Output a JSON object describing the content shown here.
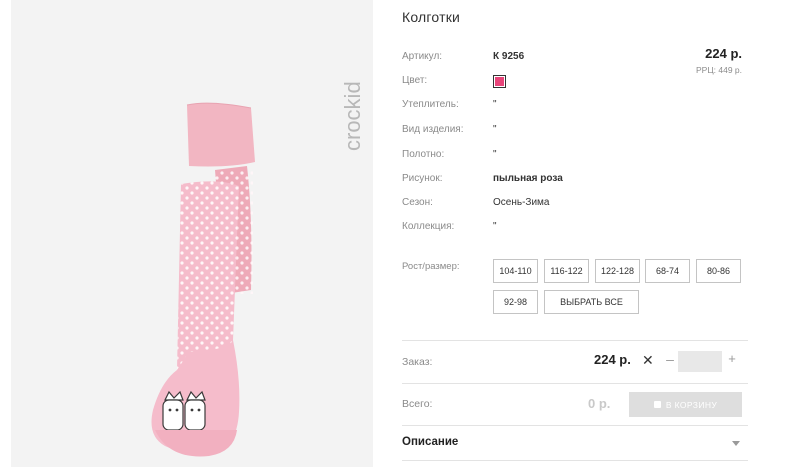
{
  "product": {
    "title": "Колготки",
    "brand": "crockid",
    "price": "224 р.",
    "rrp": "РРЦ: 449 р."
  },
  "attributes": [
    {
      "label": "Артикул:",
      "value": "К 9256"
    },
    {
      "label": "Цвет:",
      "value": ""
    },
    {
      "label": "Утеплитель:",
      "value": "\""
    },
    {
      "label": "Вид изделия:",
      "value": "\""
    },
    {
      "label": "Полотно:",
      "value": "\""
    },
    {
      "label": "Рисунок:",
      "value": "пыльная роза"
    },
    {
      "label": "Сезон:",
      "value": "Осень-Зима"
    },
    {
      "label": "Коллекция:",
      "value": "\""
    }
  ],
  "colors": {
    "swatch": "#e8457a",
    "accent": "#333333",
    "button_disabled": "#dedede"
  },
  "sizes": {
    "label": "Рост/размер:",
    "options": [
      "104-110",
      "116-122",
      "122-128",
      "68-74",
      "80-86",
      "92-98"
    ],
    "select_all": "ВЫБРАТЬ ВСЕ"
  },
  "order": {
    "label": "Заказ:",
    "price": "224 р.",
    "times": "✕",
    "minus": "–",
    "plus": "+",
    "quantity": ""
  },
  "total": {
    "label": "Всего:",
    "value": "0 р.",
    "cart_button": "В КОРЗИНУ"
  },
  "description": {
    "title": "Описание"
  }
}
